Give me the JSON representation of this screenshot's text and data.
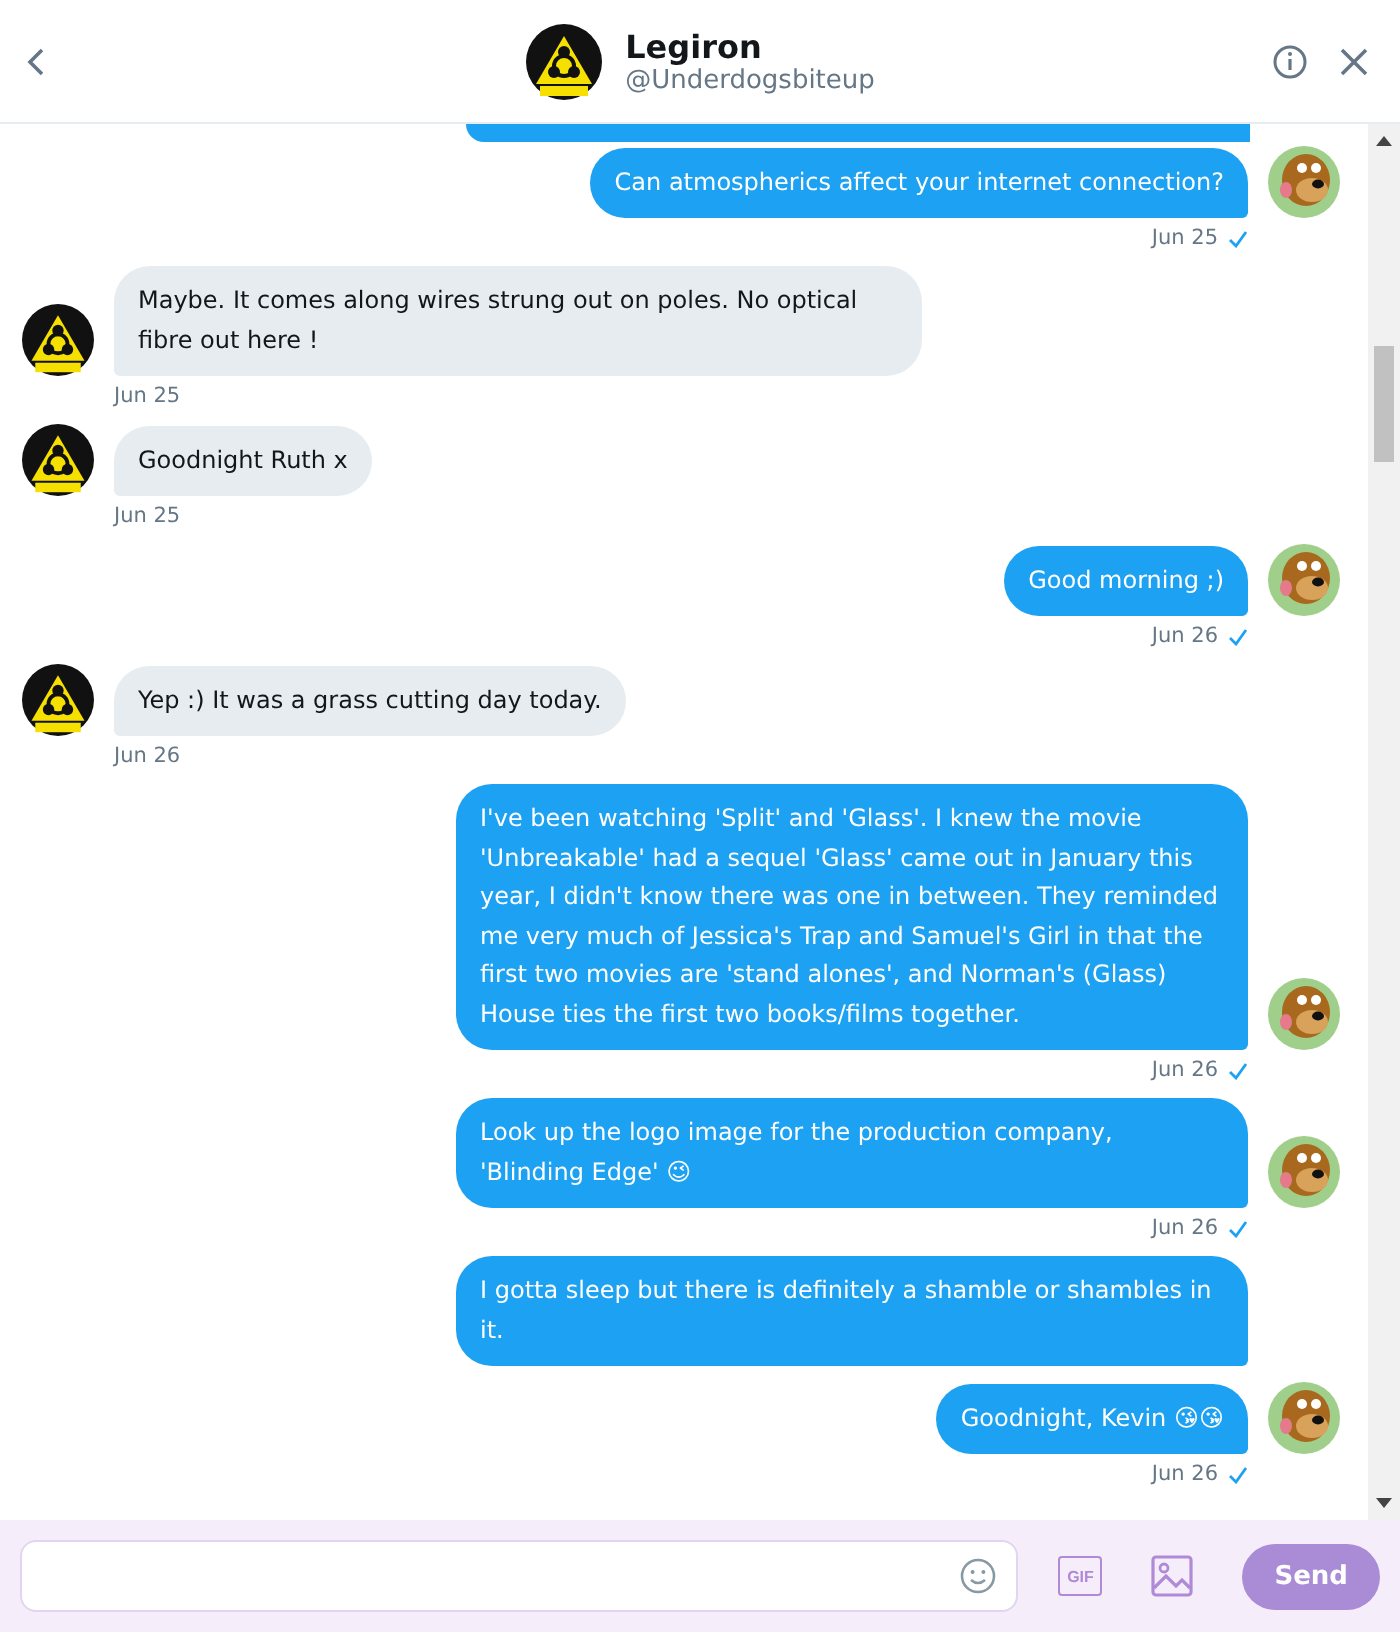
{
  "header": {
    "name": "Legiron",
    "handle": "@Underdogsbiteup"
  },
  "messages": [
    {
      "kind": "sent",
      "text": "Can atmospherics affect your internet connection?",
      "time": "Jun 25",
      "read": true
    },
    {
      "kind": "received",
      "text": "Maybe. It comes along wires strung out on poles. No optical fibre out here !",
      "time": "Jun 25"
    },
    {
      "kind": "received",
      "text": "Goodnight Ruth x",
      "time": "Jun 25"
    },
    {
      "kind": "sent",
      "text": "Good morning ;)",
      "time": "Jun 26",
      "read": true
    },
    {
      "kind": "received",
      "text": "Yep :) It was a grass cutting day today.",
      "time": "Jun 26"
    },
    {
      "kind": "sent",
      "text": "I've been watching 'Split' and 'Glass'. I knew the movie 'Unbreakable' had a sequel 'Glass' came out in January this year, I didn't know there was one in between. They reminded me very much of Jessica's Trap and Samuel's Girl in that the first two movies are 'stand alones', and Norman's (Glass) House ties the first two books/films together.",
      "time": "Jun 26",
      "read": true
    },
    {
      "kind": "sent",
      "text": "Look up the logo image for the production company, 'Blinding Edge' 😉",
      "time": "Jun 26",
      "read": true
    },
    {
      "kind": "sent",
      "text": "I gotta sleep but there is definitely a shamble or shambles in it."
    },
    {
      "kind": "sent",
      "text": "Goodnight, Kevin 😘😘",
      "time": "Jun 26",
      "read": true
    }
  ],
  "composer": {
    "send": "Send",
    "gif": "GIF",
    "send_disabled": true
  }
}
